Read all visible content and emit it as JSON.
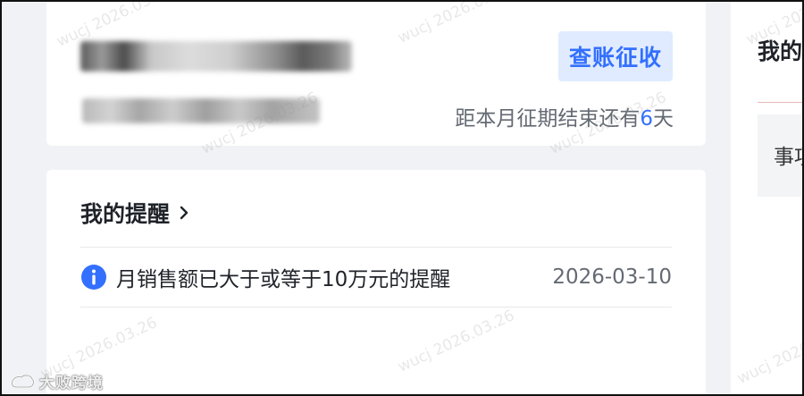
{
  "account_card": {
    "tag_button_label": "查账征收",
    "countdown": {
      "prefix": "距本月征期结束还有",
      "days": "6",
      "suffix": "天"
    }
  },
  "reminders": {
    "title": "我的提醒",
    "items": [
      {
        "text": "月销售额已大于或等于10万元的提醒",
        "date": "2026-03-10"
      }
    ]
  },
  "right_panel": {
    "title": "我的",
    "item_text": "事项"
  },
  "watermark": {
    "text": "wucj 2026.03.26"
  },
  "logo": {
    "text": "大败跨境"
  },
  "colors": {
    "accent": "#3370ff",
    "tag_bg": "#e0ebff",
    "info_icon": "#3370ff"
  }
}
